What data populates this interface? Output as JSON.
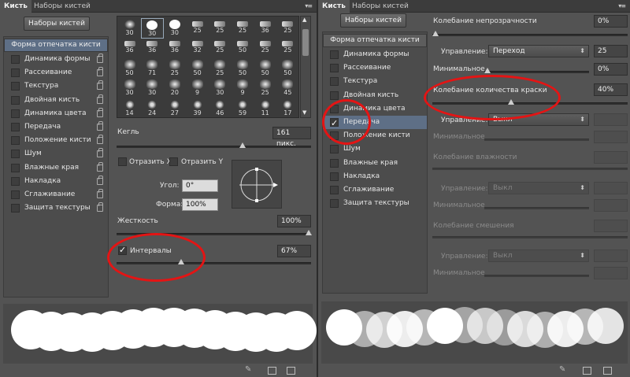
{
  "left": {
    "tabs": [
      "Кисть",
      "Наборы кистей"
    ],
    "presets_button": "Наборы кистей",
    "list_header": "Форма отпечатка кисти",
    "list": [
      {
        "label": "Динамика формы",
        "checked": false
      },
      {
        "label": "Рассеивание",
        "checked": false
      },
      {
        "label": "Текстура",
        "checked": false
      },
      {
        "label": "Двойная кисть",
        "checked": false
      },
      {
        "label": "Динамика цвета",
        "checked": false
      },
      {
        "label": "Передача",
        "checked": false
      },
      {
        "label": "Положение кисти",
        "checked": false
      },
      {
        "label": "Шум",
        "checked": false
      },
      {
        "label": "Влажные края",
        "checked": false
      },
      {
        "label": "Накладка",
        "checked": false
      },
      {
        "label": "Сглаживание",
        "checked": false
      },
      {
        "label": "Защита текстуры",
        "checked": false
      }
    ],
    "brush_sizes": [
      "30",
      "30",
      "30",
      "25",
      "25",
      "25",
      "36",
      "25",
      "36",
      "36",
      "36",
      "32",
      "25",
      "50",
      "25",
      "25",
      "50",
      "71",
      "25",
      "50",
      "25",
      "50",
      "50",
      "50",
      "30",
      "30",
      "20",
      "9",
      "30",
      "9",
      "25",
      "45",
      "14",
      "24",
      "27",
      "39",
      "46",
      "59",
      "11",
      "17"
    ],
    "size_label": "Кегль",
    "size_value": "161 пикс.",
    "flip_x": "Отразить X",
    "flip_y": "Отразить Y",
    "angle_label": "Угол:",
    "angle_value": "0°",
    "roundness_label": "Форма:",
    "roundness_value": "100%",
    "hardness_label": "Жесткость",
    "hardness_value": "100%",
    "spacing_label": "Интервалы",
    "spacing_value": "67%",
    "spacing_checked": true
  },
  "right": {
    "tabs": [
      "Кисть",
      "Наборы кистей"
    ],
    "presets_button": "Наборы кистей",
    "list_header": "Форма отпечатка кисти",
    "list": [
      {
        "label": "Динамика формы",
        "checked": false
      },
      {
        "label": "Рассеивание",
        "checked": false
      },
      {
        "label": "Текстура",
        "checked": false
      },
      {
        "label": "Двойная кисть",
        "checked": false
      },
      {
        "label": "Динамика цвета",
        "checked": false
      },
      {
        "label": "Передача",
        "checked": true
      },
      {
        "label": "Положение кисти",
        "checked": false
      },
      {
        "label": "Шум",
        "checked": false
      },
      {
        "label": "Влажные края",
        "checked": false
      },
      {
        "label": "Накладка",
        "checked": false
      },
      {
        "label": "Сглаживание",
        "checked": false
      },
      {
        "label": "Защита текстуры",
        "checked": false
      }
    ],
    "opacity_jitter_label": "Колебание непрозрачности",
    "opacity_jitter_value": "0%",
    "control_label": "Управление:",
    "control_value": "Переход",
    "control_steps": "25",
    "minimum_label": "Минимальное",
    "minimum_value": "0%",
    "flow_jitter_label": "Колебание количества краски",
    "flow_jitter_value": "40%",
    "control2_value": "Выкл",
    "wetness_label": "Колебание влажности",
    "control3_value": "Выкл",
    "mix_label": "Колебание смешения",
    "control4_value": "Выкл"
  }
}
